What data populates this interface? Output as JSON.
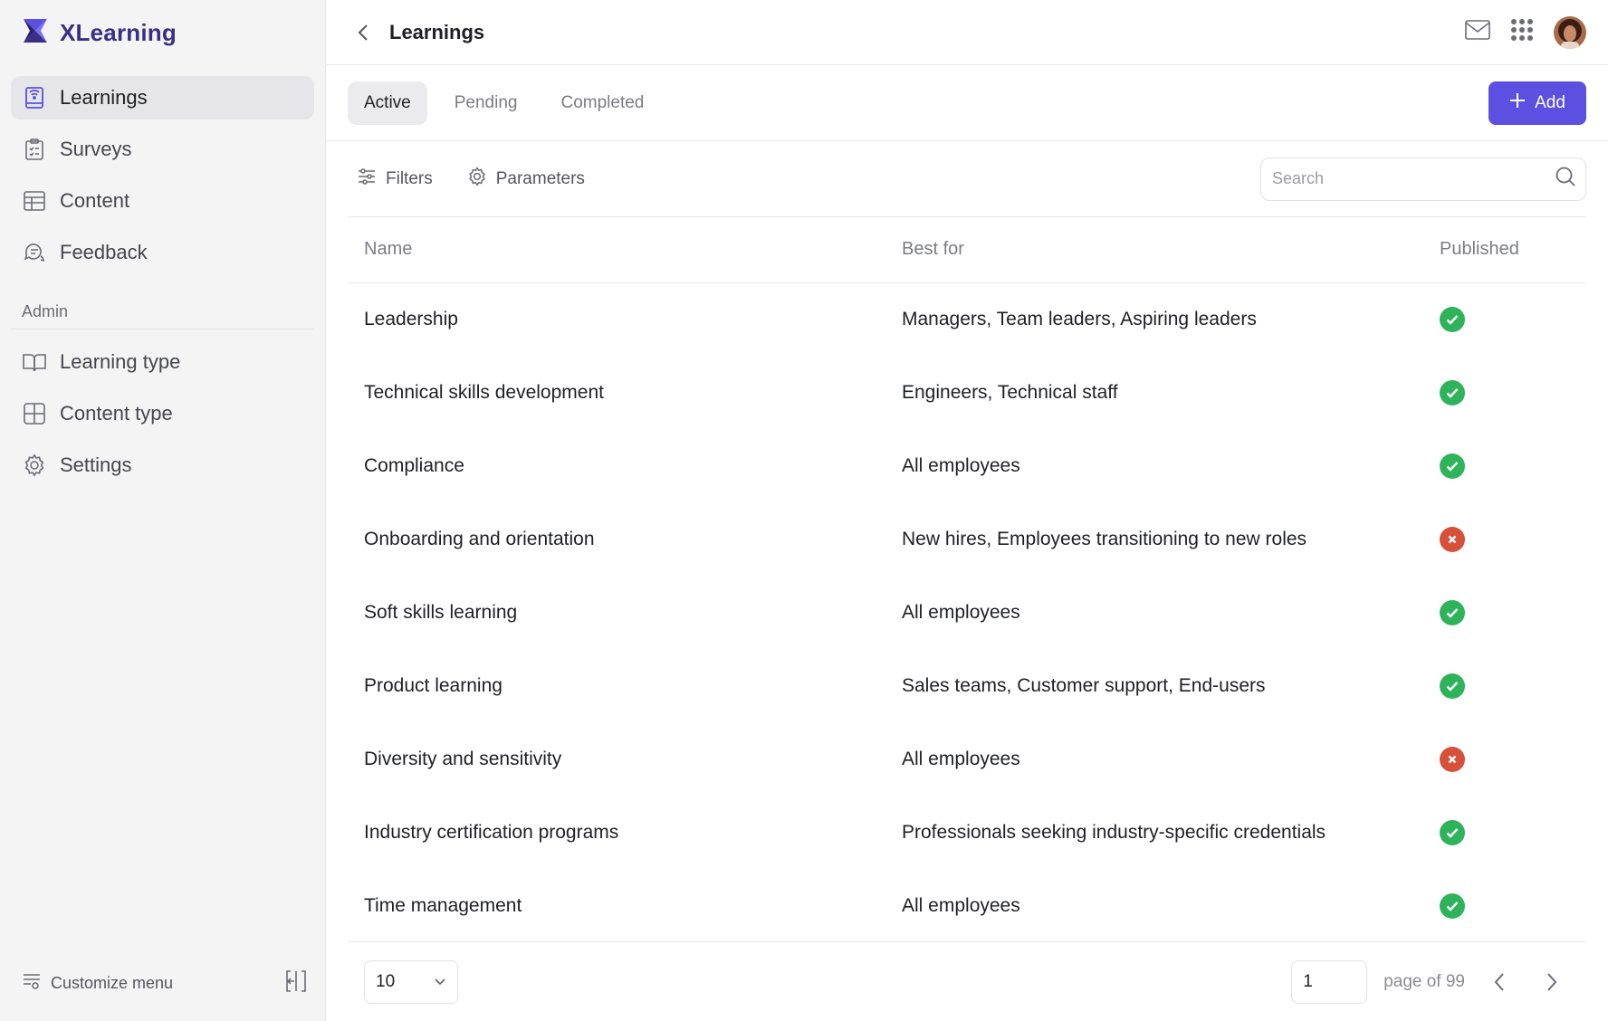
{
  "app": {
    "name": "XLearning"
  },
  "sidebar": {
    "items": [
      {
        "label": "Learnings",
        "icon": "book-icon",
        "active": true
      },
      {
        "label": "Surveys",
        "icon": "clipboard-icon",
        "active": false
      },
      {
        "label": "Content",
        "icon": "table-icon",
        "active": false
      },
      {
        "label": "Feedback",
        "icon": "chat-icon",
        "active": false
      }
    ],
    "admin_label": "Admin",
    "admin_items": [
      {
        "label": "Learning type",
        "icon": "open-book-icon"
      },
      {
        "label": "Content type",
        "icon": "grid-icon"
      },
      {
        "label": "Settings",
        "icon": "gear-icon"
      }
    ],
    "customize_label": "Customize menu"
  },
  "header": {
    "title": "Learnings"
  },
  "tabs": [
    {
      "label": "Active",
      "active": true
    },
    {
      "label": "Pending",
      "active": false
    },
    {
      "label": "Completed",
      "active": false
    }
  ],
  "add_label": "Add",
  "toolbar": {
    "filters_label": "Filters",
    "parameters_label": "Parameters",
    "search_placeholder": "Search"
  },
  "table": {
    "columns": [
      "Name",
      "Best for",
      "Published"
    ],
    "rows": [
      {
        "name": "Leadership",
        "best_for": "Managers, Team leaders, Aspiring leaders",
        "published": true
      },
      {
        "name": "Technical skills development",
        "best_for": "Engineers, Technical staff",
        "published": true
      },
      {
        "name": "Compliance",
        "best_for": "All employees",
        "published": true
      },
      {
        "name": "Onboarding and orientation",
        "best_for": "New hires, Employees transitioning to new roles",
        "published": false
      },
      {
        "name": "Soft skills learning",
        "best_for": "All employees",
        "published": true
      },
      {
        "name": "Product learning",
        "best_for": "Sales teams, Customer support, End-users",
        "published": true
      },
      {
        "name": "Diversity and sensitivity",
        "best_for": "All employees",
        "published": false
      },
      {
        "name": "Industry certification programs",
        "best_for": "Professionals seeking industry-specific credentials",
        "published": true
      },
      {
        "name": "Time management",
        "best_for": "All employees",
        "published": true
      }
    ]
  },
  "pagination": {
    "page_size": "10",
    "current_page": "1",
    "page_of": "page of 99"
  },
  "colors": {
    "brand": "#3a2f86",
    "accent": "#5b50e0",
    "published": "#2fb35a",
    "unpublished": "#d6503a"
  }
}
